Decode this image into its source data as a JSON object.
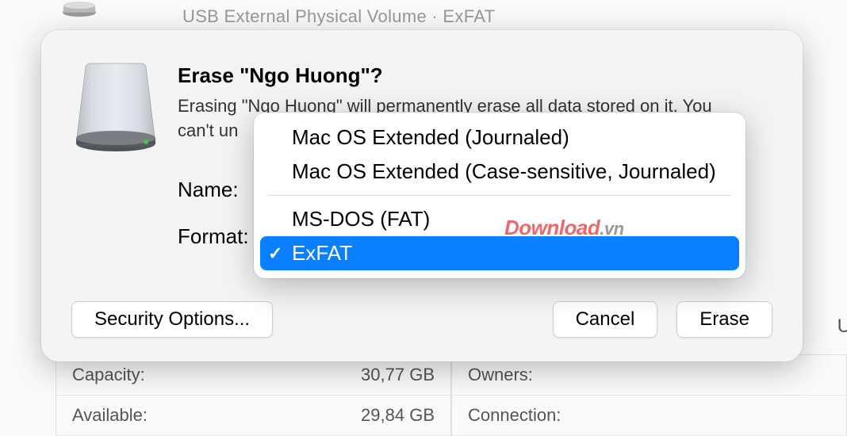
{
  "background": {
    "top_text": "USB External Physical Volume · ExFAT",
    "info": {
      "capacity_label": "Capacity:",
      "capacity_value": "30,77 GB",
      "available_label": "Available:",
      "available_value": "29,84 GB",
      "owners_label": "Owners:",
      "connection_label": "Connection:"
    },
    "right_edge": "U"
  },
  "dialog": {
    "title": "Erase \"Ngo Huong\"?",
    "description_line1": "Erasing \"Ngo Huong\" will permanently erase all data stored on it. You",
    "description_line2": "can't un",
    "name_label": "Name:",
    "format_label": "Format:",
    "security_button": "Security Options...",
    "cancel_button": "Cancel",
    "erase_button": "Erase"
  },
  "dropdown": {
    "options": [
      {
        "label": "Mac OS Extended (Journaled)",
        "selected": false
      },
      {
        "label": "Mac OS Extended (Case-sensitive, Journaled)",
        "selected": false
      },
      {
        "label": "MS-DOS (FAT)",
        "selected": false
      },
      {
        "label": "ExFAT",
        "selected": true
      }
    ]
  },
  "watermark": {
    "main": "Download",
    "suffix": ".vn"
  }
}
